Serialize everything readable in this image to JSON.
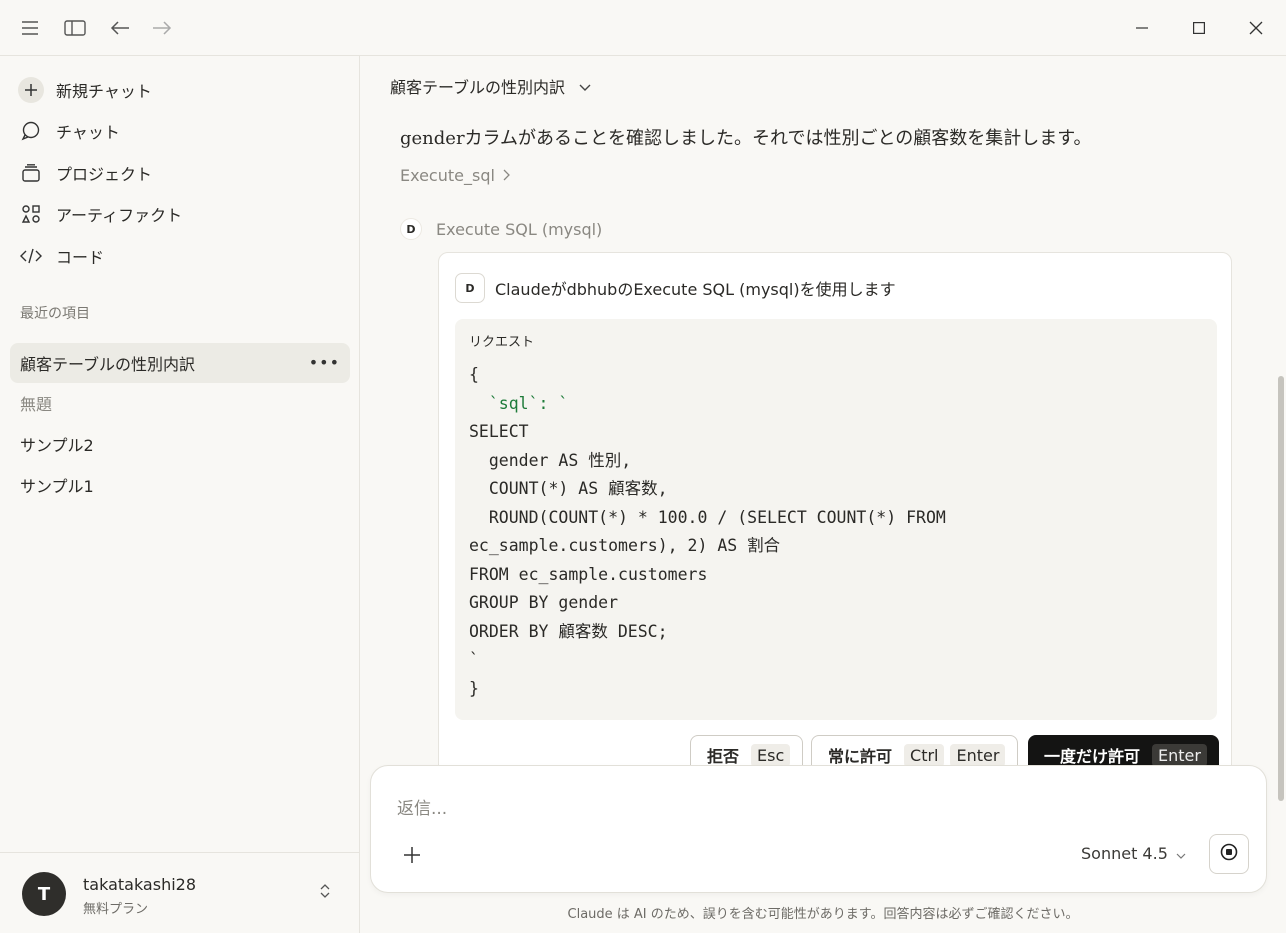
{
  "titlebar": {
    "menu_icon": "hamburger-icon",
    "sidebar_icon": "sidebar-toggle-icon",
    "back_icon": "arrow-left-icon",
    "forward_icon": "arrow-right-icon"
  },
  "sidebar": {
    "nav": [
      {
        "label": "新規チャット",
        "icon": "plus-icon"
      },
      {
        "label": "チャット",
        "icon": "chat-bubble-icon"
      },
      {
        "label": "プロジェクト",
        "icon": "folder-stack-icon"
      },
      {
        "label": "アーティファクト",
        "icon": "artifacts-icon"
      },
      {
        "label": "コード",
        "icon": "code-icon"
      }
    ],
    "recent_label": "最近の項目",
    "recent": [
      {
        "label": "顧客テーブルの性別内訳",
        "active": true
      },
      {
        "label": "無題"
      },
      {
        "label": "サンプル2"
      },
      {
        "label": "サンプル1"
      }
    ],
    "user": {
      "initial": "T",
      "name": "takatakashi28",
      "plan": "無料プラン"
    }
  },
  "main": {
    "chat_title": "顧客テーブルの性別内訳",
    "message": "genderカラムがあることを確認しました。それでは性別ごとの顧客数を集計します。",
    "tool_link": "Execute_sql",
    "tool_head": {
      "badge": "D",
      "label": "Execute SQL (mysql)"
    },
    "permission": {
      "badge": "D",
      "heading": "ClaudeがdbhubのExecute SQL (mysql)を使用します",
      "request_label": "リクエスト",
      "code_lines": [
        "{",
        "  `sql`: `",
        "SELECT",
        "  gender AS 性別,",
        "  COUNT(*) AS 顧客数,",
        "  ROUND(COUNT(*) * 100.0 / (SELECT COUNT(*) FROM",
        "ec_sample.customers), 2) AS 割合",
        "FROM ec_sample.customers",
        "GROUP BY gender",
        "ORDER BY 顧客数 DESC;",
        "`",
        "}"
      ],
      "buttons": {
        "deny": {
          "label": "拒否",
          "key": "Esc"
        },
        "always": {
          "label": "常に許可",
          "key1": "Ctrl",
          "key2": "Enter"
        },
        "once": {
          "label": "一度だけ許可",
          "key": "Enter"
        }
      }
    },
    "input": {
      "placeholder": "返信...",
      "model": "Sonnet 4.5"
    },
    "disclaimer": "Claude は AI のため、誤りを含む可能性があります。回答内容は必ずご確認ください。"
  },
  "colors": {
    "background": "#f9f8f5",
    "accent_dark": "#141413",
    "code_key": "#1e7b3a"
  }
}
